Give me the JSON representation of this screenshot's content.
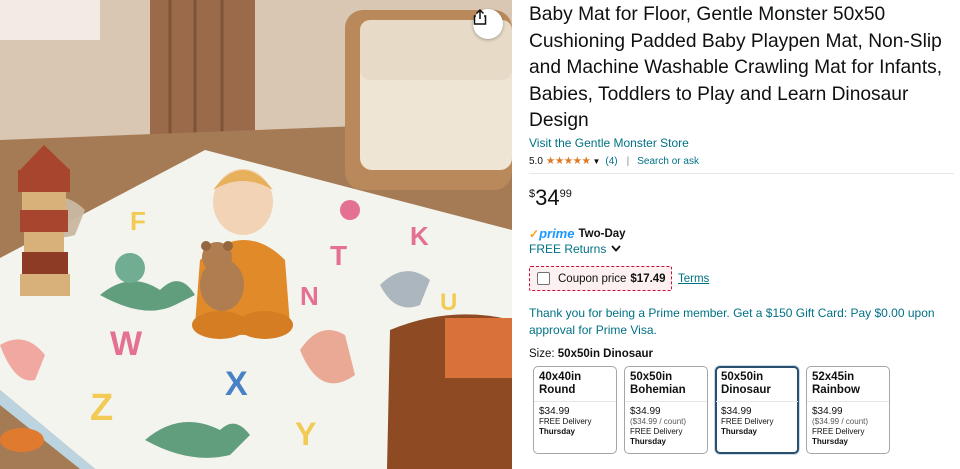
{
  "product": {
    "title": "Baby Mat for Floor, Gentle Monster 50x50 Cushioning Padded Baby Playpen Mat, Non-Slip and Machine Washable Crawling Mat for Infants, Babies, Toddlers to Play and Learn Dinosaur Design",
    "store_link": "Visit the Gentle Monster Store",
    "rating": "5.0",
    "stars": "★★★★★",
    "rating_count": "(4)",
    "separator": "|",
    "search_link": "Search or ask"
  },
  "price": {
    "symbol": "$",
    "whole": "34",
    "fraction": "99"
  },
  "prime": {
    "check": "✓",
    "word": "prime",
    "label": "Two-Day"
  },
  "returns": {
    "label": "FREE Returns"
  },
  "coupon": {
    "label": "Coupon price",
    "value": "$17.49",
    "terms": "Terms"
  },
  "prime_offer": "Thank you for being a Prime member. Get a $150 Gift Card: Pay $0.00 upon approval for Prime Visa.",
  "size": {
    "label": "Size:",
    "selected": "50x50in Dinosaur"
  },
  "variations": [
    {
      "name": "40x40in Round",
      "price": "$34.99",
      "unit": "",
      "delivery": "FREE Delivery",
      "day": "Thursday",
      "selected": false
    },
    {
      "name": "50x50in Bohemian",
      "price": "$34.99",
      "unit": "($34.99 / count)",
      "delivery": "FREE Delivery",
      "day": "Thursday",
      "selected": false
    },
    {
      "name": "50x50in Dinosaur",
      "price": "$34.99",
      "unit": "",
      "delivery": "FREE Delivery",
      "day": "Thursday",
      "selected": true
    },
    {
      "name": "52x45in Rainbow",
      "price": "$34.99",
      "unit": "($34.99 / count)",
      "delivery": "FREE Delivery",
      "day": "Thursday",
      "selected": false
    }
  ],
  "icons": {
    "share": "share-icon",
    "chevron": "chevron-down-icon"
  },
  "colors": {
    "link": "#007185",
    "star": "#de7921",
    "prime_blue": "#1a98ff",
    "coupon_border": "#cc0c39",
    "selected_border": "#2a4f6e"
  }
}
